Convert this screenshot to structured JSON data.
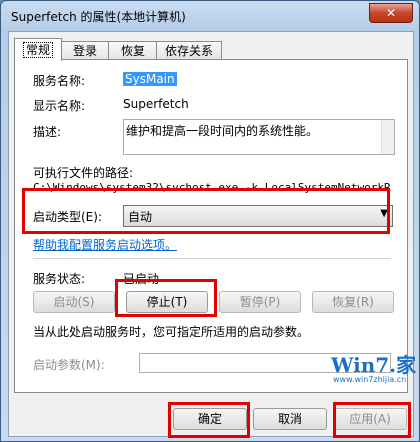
{
  "window": {
    "title": "Superfetch 的属性(本地计算机)",
    "close_glyph": "✕"
  },
  "tabs": [
    {
      "label": "常规",
      "active": true
    },
    {
      "label": "登录",
      "active": false
    },
    {
      "label": "恢复",
      "active": false
    },
    {
      "label": "依存关系",
      "active": false
    }
  ],
  "general": {
    "service_name_label": "服务名称:",
    "service_name_value": "SysMain",
    "display_name_label": "显示名称:",
    "display_name_value": "Superfetch",
    "description_label": "描述:",
    "description_value": "维护和提高一段时间内的系统性能。",
    "path_label": "可执行文件的路径:",
    "path_value": "C:\\Windows\\system32\\svchost.exe -k LocalSystemNetworkRestric",
    "startup_type_label": "启动类型(E):",
    "startup_type_value": "自动",
    "help_link": "帮助我配置服务启动选项。",
    "status_label": "服务状态:",
    "status_value": "已启动",
    "start_btn": "启动(S)",
    "stop_btn": "停止(T)",
    "pause_btn": "暂停(P)",
    "resume_btn": "恢复(R)",
    "hint_text": "当从此处启动服务时，您可指定所适用的启动参数。",
    "start_params_label": "启动参数(M):",
    "start_params_value": ""
  },
  "footer": {
    "ok_btn": "确定",
    "cancel_btn": "取消",
    "apply_btn": "应用(A)"
  },
  "watermark": {
    "text": "Win7.家",
    "url": "www.win7zhijia.cn"
  },
  "colors": {
    "highlight_box": "#e00000",
    "link": "#0066cc",
    "selection": "#3399ff"
  }
}
